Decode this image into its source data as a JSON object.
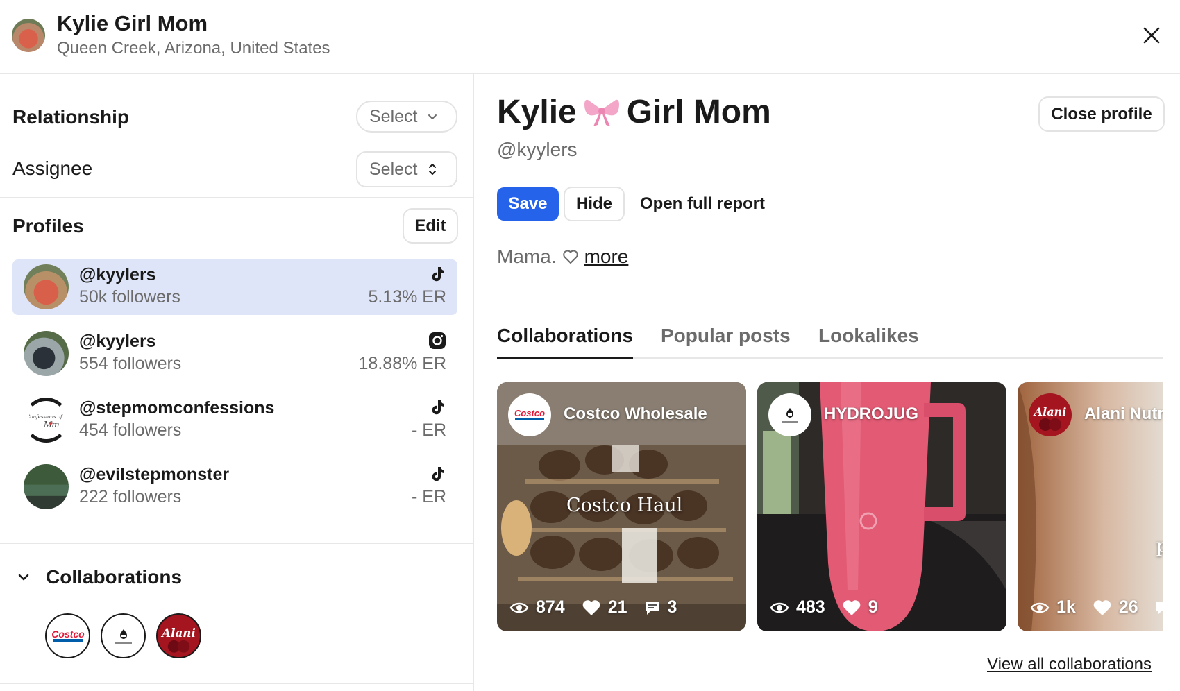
{
  "header": {
    "name": "Kylie Girl Mom",
    "location": "Queen Creek, Arizona, United States"
  },
  "left": {
    "relationship": {
      "label": "Relationship",
      "select": "Select"
    },
    "assignee": {
      "label": "Assignee",
      "select": "Select"
    },
    "profiles": {
      "title": "Profiles",
      "edit_label": "Edit",
      "items": [
        {
          "handle": "@kyylers",
          "followers": "50k followers",
          "er": "5.13% ER",
          "platform": "tiktok-icon",
          "active": true
        },
        {
          "handle": "@kyylers",
          "followers": "554 followers",
          "er": "18.88% ER",
          "platform": "instagram-icon",
          "active": false
        },
        {
          "handle": "@stepmomconfessions",
          "followers": "454 followers",
          "er": "- ER",
          "platform": "tiktok-icon",
          "active": false
        },
        {
          "handle": "@evilstepmonster",
          "followers": "222 followers",
          "er": "- ER",
          "platform": "tiktok-icon",
          "active": false
        }
      ]
    },
    "collaborations": {
      "title": "Collaborations",
      "brands": [
        "Costco",
        "HYDROJUG",
        "Alani"
      ]
    }
  },
  "right": {
    "name_first": "Kylie",
    "name_last": "Girl Mom",
    "name_emoji": "bow-icon",
    "handle": "@kyylers",
    "close_profile": "Close profile",
    "save": "Save",
    "hide": "Hide",
    "open_report": "Open full report",
    "bio": "Mama.",
    "bio_more": "more",
    "tabs": [
      {
        "label": "Collaborations",
        "active": true
      },
      {
        "label": "Popular posts",
        "active": false
      },
      {
        "label": "Lookalikes",
        "active": false
      }
    ],
    "cards": [
      {
        "brand": "Costco Wholesale",
        "logo_text": "Costco",
        "logo_subtext": "WHOLESALE",
        "overlay": "Costco Haul",
        "views": "874",
        "likes": "21",
        "comments": "3"
      },
      {
        "brand": "HYDROJUG",
        "logo_text": "HYDROJUG",
        "overlay": "",
        "views": "483",
        "likes": "9",
        "comments": ""
      },
      {
        "brand": "Alani Nutrition",
        "logo_text": "Alani",
        "overlay": "POV: Your postpartum",
        "views": "1k",
        "likes": "26",
        "comments": ""
      }
    ],
    "view_all": "View all collaborations"
  },
  "colors": {
    "accent": "#2563eb",
    "active_row": "#dfe5f8",
    "costco_red": "#e31837",
    "costco_blue": "#005daa"
  }
}
